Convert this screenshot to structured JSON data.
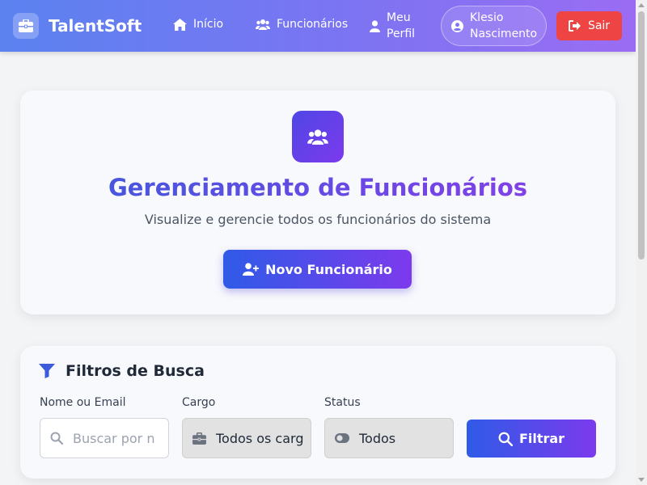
{
  "navbar": {
    "brand": "TalentSoft",
    "links": {
      "home": "Início",
      "employees": "Funcionários",
      "profile_line1": "Meu",
      "profile_line2": "Perfil"
    },
    "user": {
      "first_name": "Klesio",
      "last_name": "Nascimento"
    },
    "logout_label": "Sair"
  },
  "hero": {
    "title": "Gerenciamento de Funcionários",
    "subtitle": "Visualize e gerencie todos os funcionários do sistema",
    "new_button_label": "Novo Funcionário"
  },
  "filters": {
    "title": "Filtros de Busca",
    "name_label": "Nome ou Email",
    "name_placeholder": "Buscar por n",
    "cargo_label": "Cargo",
    "cargo_value": "Todos os carg",
    "status_label": "Status",
    "status_value": "Todos",
    "filter_button_label": "Filtrar"
  },
  "colors": {
    "navbar_gradient_start": "#5b82f0",
    "navbar_gradient_end": "#9a6cf3",
    "accent_blue": "#2f5be7",
    "accent_purple": "#7c3aed",
    "logout_red": "#ef4444"
  },
  "icons": {
    "brand": "briefcase-icon",
    "home": "home-icon",
    "employees": "users-icon",
    "profile": "user-icon",
    "user_pill": "user-circle-icon",
    "logout": "sign-out-icon",
    "hero": "users-icon",
    "new_employee": "user-plus-icon",
    "filters": "filter-icon",
    "search_input": "search-icon",
    "cargo": "briefcase-icon",
    "status": "toggle-icon",
    "filter_button": "search-icon"
  }
}
